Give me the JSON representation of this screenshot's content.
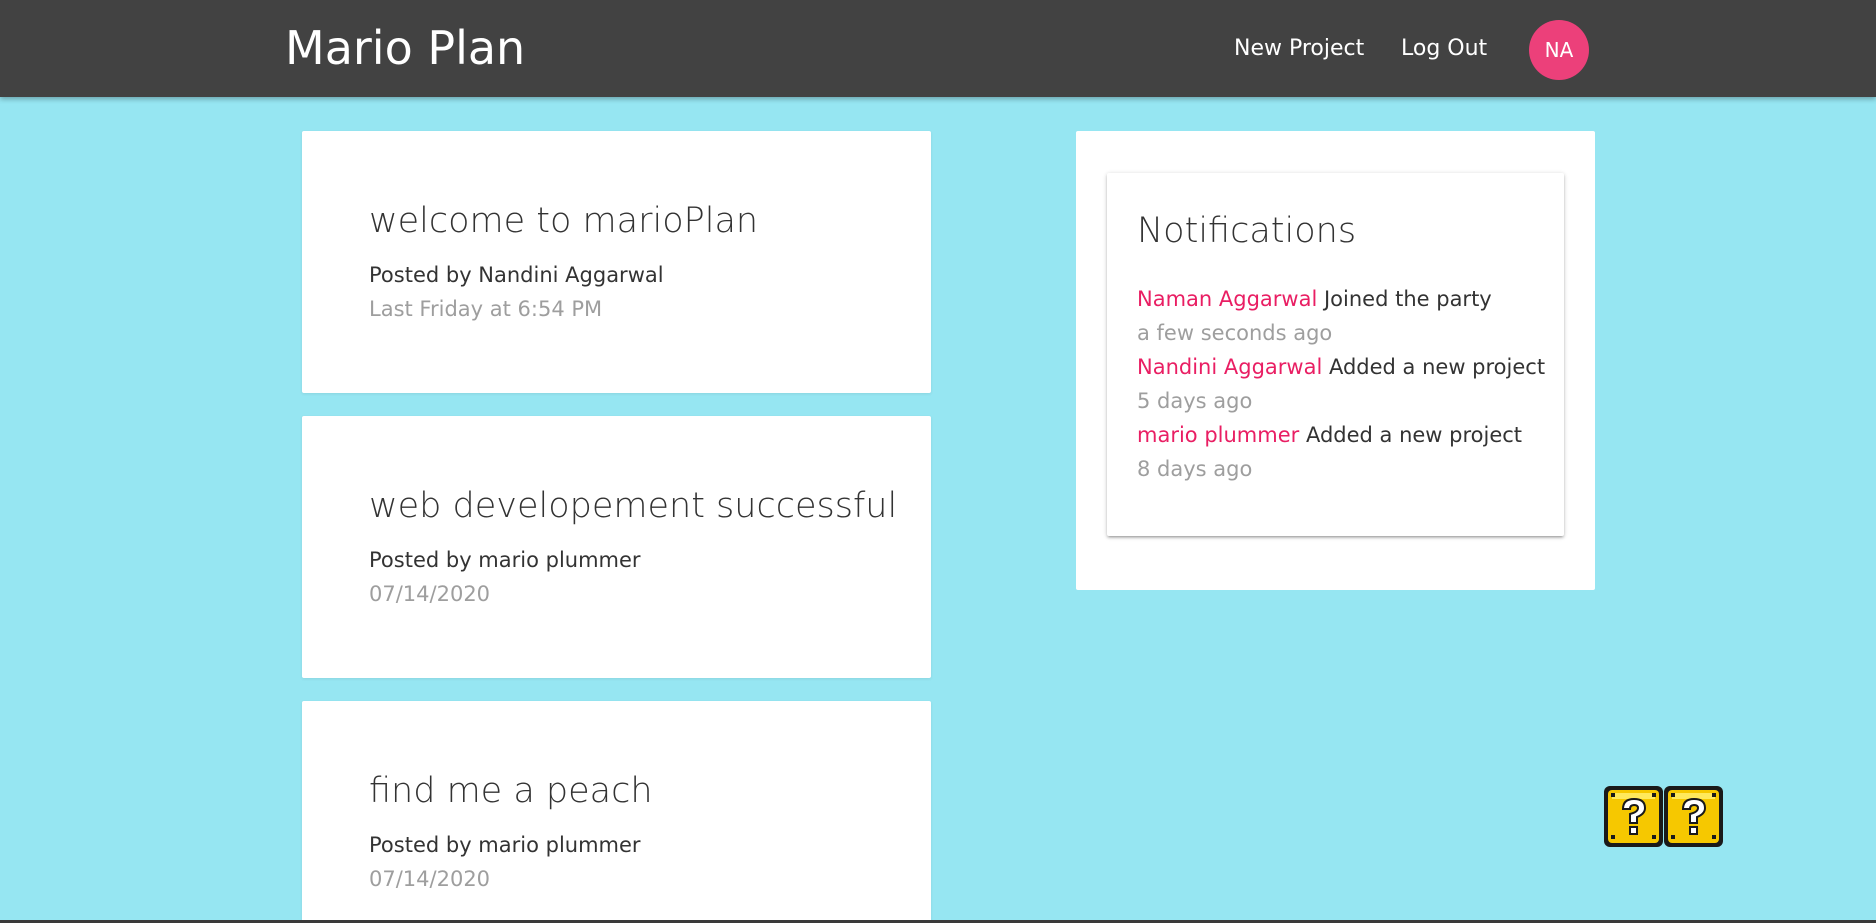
{
  "navbar": {
    "brand": "Mario Plan",
    "links": {
      "new_project": "New Project",
      "log_out": "Log Out"
    },
    "avatar_initials": "NA",
    "colors": {
      "bar": "#424242",
      "avatar": "#ec407a"
    }
  },
  "projects": [
    {
      "title": "welcome to marioPlan",
      "author": "Posted by Nandini Aggarwal",
      "date": "Last Friday at 6:54 PM"
    },
    {
      "title": "web developement successful",
      "author": "Posted by mario plummer",
      "date": "07/14/2020"
    },
    {
      "title": "find me a peach",
      "author": "Posted by mario plummer",
      "date": "07/14/2020"
    }
  ],
  "notifications": {
    "title": "Notifications",
    "items": [
      {
        "user": "Naman Aggarwal",
        "content": "Joined the party",
        "time": "a few seconds ago"
      },
      {
        "user": "Nandini Aggarwal",
        "content": "Added a new project",
        "time": "5 days ago"
      },
      {
        "user": "mario plummer",
        "content": "Added a new project",
        "time": "8 days ago"
      }
    ]
  },
  "decoration": {
    "icon": "question-block-icon",
    "count": 2
  },
  "colors": {
    "page_background": "#96e6f2",
    "accent": "#e91e63",
    "muted_text": "#9e9e9e"
  }
}
